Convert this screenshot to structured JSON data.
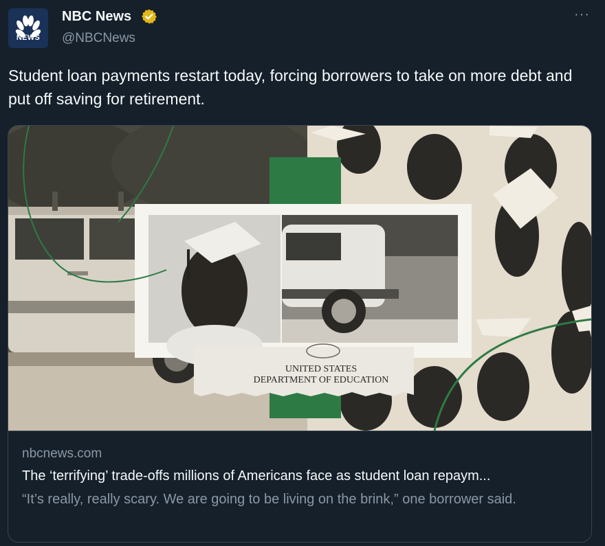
{
  "author": {
    "name": "NBC News",
    "handle": "@NBCNews",
    "avatar_text": "NEWS",
    "verified_color": "#e2b719"
  },
  "tweet": {
    "text": "Student loan payments restart today, forcing borrowers to take on more debt and put off saving for retirement."
  },
  "card": {
    "domain": "nbcnews.com",
    "title": "The ‘terrifying’ trade-offs millions of Americans face as student loan repaym...",
    "description": "“It’s really, really scary. We are going to be living on the brink,” one borrower said.",
    "image_label_line1": "UNITED STATES",
    "image_label_line2": "DEPARTMENT OF EDUCATION"
  },
  "colors": {
    "background": "#15202b",
    "text_primary": "#f7f9f9",
    "text_secondary": "#8b98a5",
    "border": "#38444d",
    "accent_green": "#2d7a45"
  }
}
